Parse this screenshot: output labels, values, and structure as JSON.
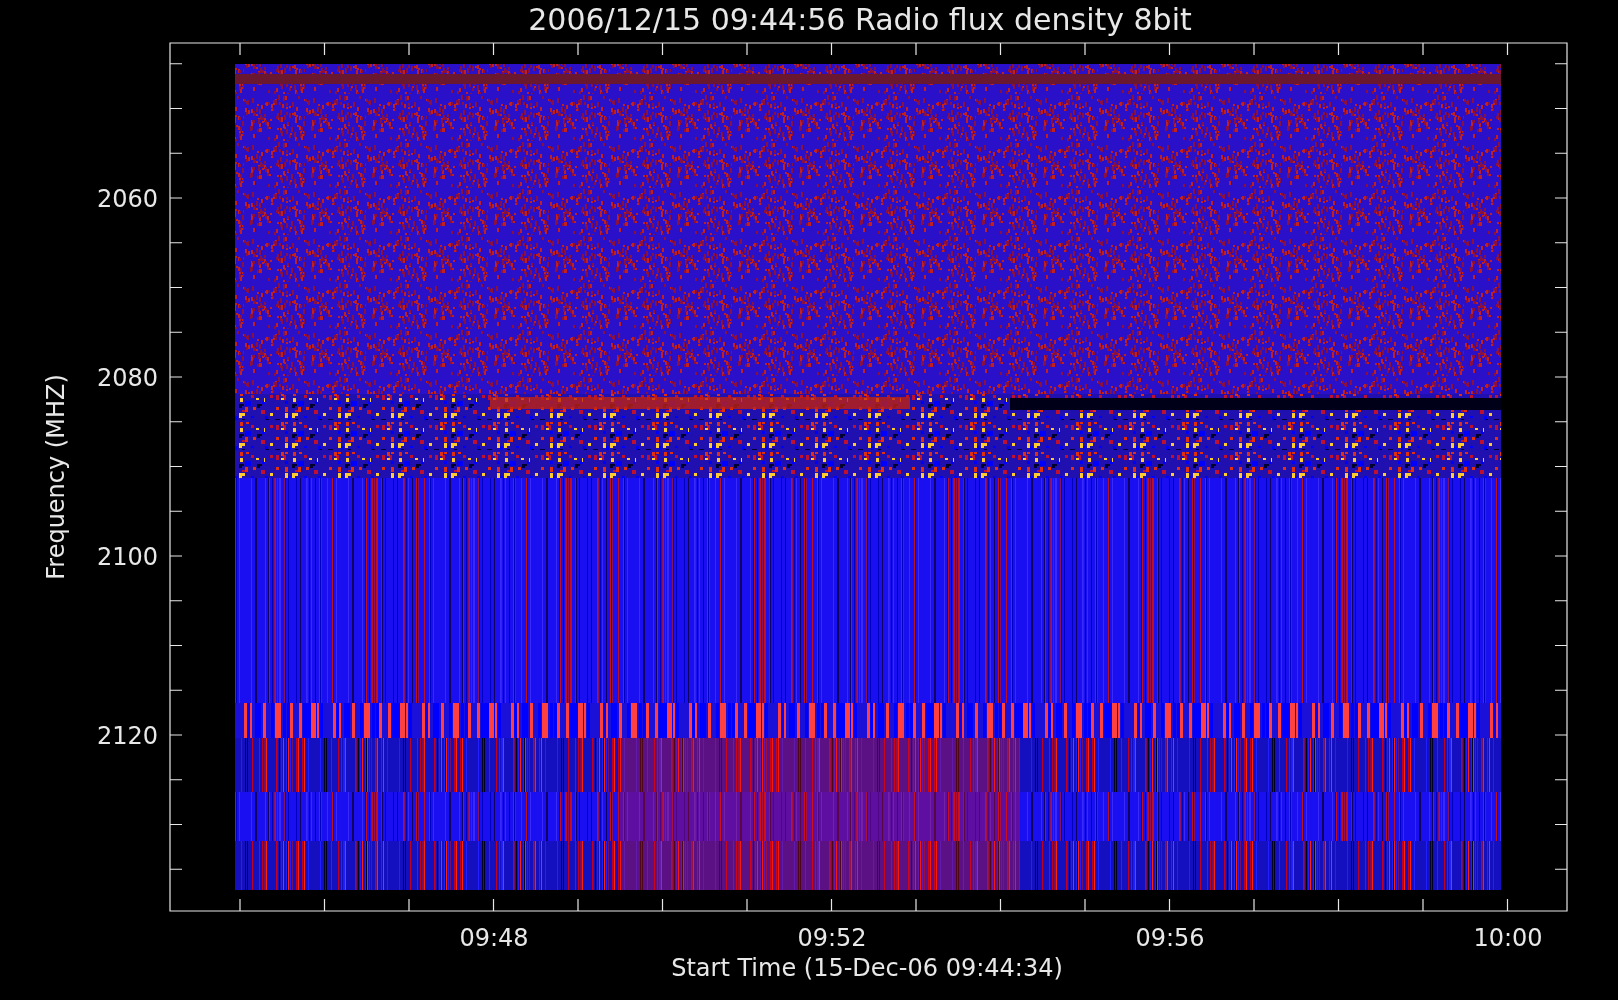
{
  "title": "2006/12/15 09:44:56 Radio flux density 8bit",
  "plot": {
    "ylabel": "Frequency (MHZ)",
    "xlabel": "Start Time (15-Dec-06 09:44:34)",
    "yticks": [
      "2060",
      "2080",
      "2100",
      "2120"
    ],
    "xticks": [
      "09:48",
      "09:52",
      "09:56",
      "10:00"
    ]
  }
}
